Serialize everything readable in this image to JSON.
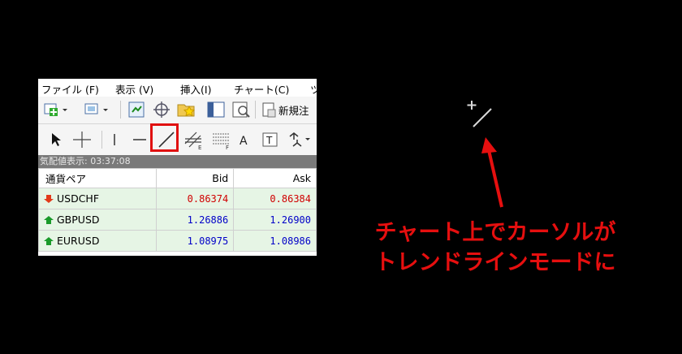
{
  "menu": [
    "ファイル (F)",
    "表示 (V)",
    "挿入(I)",
    "チャート(C)",
    "ツ"
  ],
  "toolbar": {
    "new_label": "新規注"
  },
  "status_text": "気配値表示: 03:37:08",
  "table": {
    "headers": [
      "通貨ペア",
      "Bid",
      "Ask"
    ],
    "rows": [
      {
        "symbol": "USDCHF",
        "bid": "0.86374",
        "ask": "0.86384",
        "direction": "down",
        "color": "#d00000"
      },
      {
        "symbol": "GBPUSD",
        "bid": "1.26886",
        "ask": "1.26900",
        "direction": "up",
        "color": "#0000c8"
      },
      {
        "symbol": "EURUSD",
        "bid": "1.08975",
        "ask": "1.08986",
        "direction": "up",
        "color": "#0000c8"
      }
    ]
  },
  "annotation": {
    "line1": "チャート上でカーソルが",
    "line2": "トレンドラインモードに",
    "color": "#e60f0f"
  },
  "icons": [
    "new-chart-icon",
    "profiles-icon",
    "autotrading-icon",
    "crosshair-target-icon",
    "favorites-icon",
    "navigator-icon",
    "history-icon",
    "new-order-icon",
    "cursor-icon",
    "crosshair-icon",
    "vertical-line-icon",
    "horizontal-line-icon",
    "trendline-icon",
    "equidistant-channel-icon",
    "fibonacci-icon",
    "text-icon",
    "text-label-icon",
    "arrows-icon"
  ]
}
